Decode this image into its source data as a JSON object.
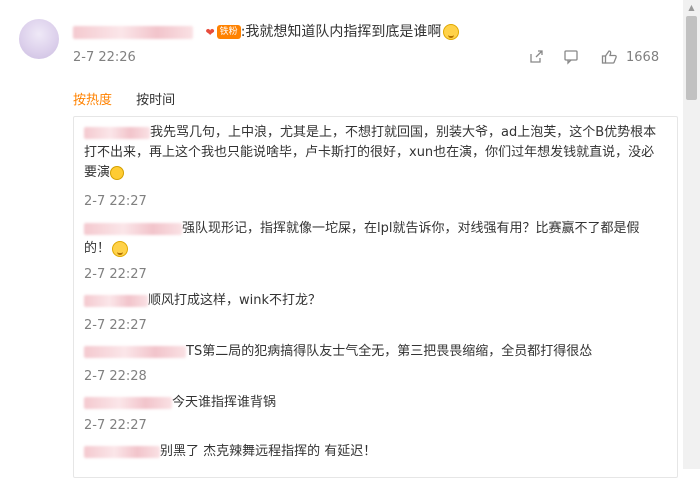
{
  "comment": {
    "text": ":我就想知道队内指挥到底是谁啊",
    "badge": "铁粉",
    "time": "2-7 22:26",
    "likes": "1668"
  },
  "tabs": [
    {
      "label": "按热度"
    },
    {
      "label": "按时间"
    }
  ],
  "replies": [
    {
      "text": "我先骂几句，上中浪，尤其是上，不想打就回国，别装大爷，ad上泡芙，这个B优势根本打不出来，再上这个我也只能说啥毕，卢卡斯打的很好，xun也在演，你们过年想发钱就直说，没必要演",
      "time": "2-7 22:27"
    },
    {
      "text": "强队现形记，指挥就像一坨屎，在lpl就告诉你，对线强有用？比赛赢不了都是假的！",
      "time": "2-7 22:27"
    },
    {
      "text": "顺风打成这样，wink不打龙？",
      "time": "2-7 22:27"
    },
    {
      "text": "TS第二局的犯病搞得队友士气全无，第三把畏畏缩缩，全员都打得很怂",
      "time": "2-7 22:28"
    },
    {
      "text": "今天谁指挥谁背锅",
      "time": "2-7 22:27"
    },
    {
      "text": "别黑了 杰克辣舞远程指挥的 有延迟！",
      "time": ""
    }
  ],
  "icons": {
    "share": "share-icon",
    "comment": "comment-icon",
    "like": "thumbs-up-icon"
  },
  "colors": {
    "accent": "#ff8200",
    "muted": "#808080"
  }
}
